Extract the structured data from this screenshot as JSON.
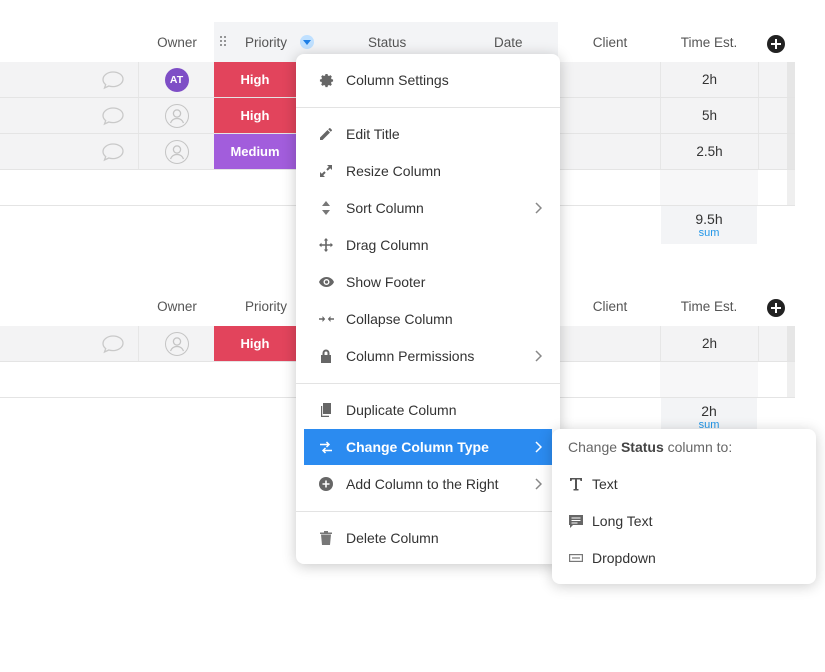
{
  "group1": {
    "headers": {
      "owner": "Owner",
      "priority": "Priority",
      "status": "Status",
      "date": "Date",
      "client": "Client",
      "time_est": "Time Est."
    },
    "rows": [
      {
        "owner_initials": "AT",
        "priority": "High",
        "time_est": "2h"
      },
      {
        "owner_initials": "",
        "priority": "High",
        "time_est": "5h"
      },
      {
        "owner_initials": "",
        "priority": "Medium",
        "time_est": "2.5h"
      }
    ],
    "sum_value": "9.5h",
    "sum_label": "sum"
  },
  "group2": {
    "headers": {
      "owner": "Owner",
      "priority": "Priority",
      "client": "Client",
      "time_est": "Time Est."
    },
    "rows": [
      {
        "owner_initials": "",
        "priority": "High",
        "time_est": "2h"
      }
    ],
    "sum_value": "2h",
    "sum_label": "sum"
  },
  "colors": {
    "high": "#e2445c",
    "medium": "#a25ddc",
    "accent": "#2b8bf0",
    "avatar": "#7e4ec6",
    "sum_label": "#2196e8"
  },
  "column_menu": {
    "items": [
      {
        "label": "Column Settings",
        "icon": "gear-icon"
      },
      {
        "label": "Edit Title",
        "icon": "pencil-icon"
      },
      {
        "label": "Resize Column",
        "icon": "resize-icon"
      },
      {
        "label": "Sort Column",
        "icon": "sort-icon",
        "submenu": true
      },
      {
        "label": "Drag Column",
        "icon": "move-icon"
      },
      {
        "label": "Show Footer",
        "icon": "eye-icon"
      },
      {
        "label": "Collapse Column",
        "icon": "collapse-icon"
      },
      {
        "label": "Column Permissions",
        "icon": "lock-icon",
        "submenu": true
      },
      {
        "label": "Duplicate Column",
        "icon": "duplicate-icon"
      },
      {
        "label": "Change Column Type",
        "icon": "swap-icon",
        "submenu": true,
        "active": true
      },
      {
        "label": "Add Column to the Right",
        "icon": "plus-circle-icon",
        "submenu": true
      },
      {
        "label": "Delete Column",
        "icon": "trash-icon"
      }
    ]
  },
  "type_submenu": {
    "title_prefix": "Change",
    "title_bold": "Status",
    "title_suffix": "column to:",
    "items": [
      {
        "label": "Text",
        "icon": "text-type-icon"
      },
      {
        "label": "Long Text",
        "icon": "long-text-icon"
      },
      {
        "label": "Dropdown",
        "icon": "dropdown-icon"
      }
    ]
  }
}
